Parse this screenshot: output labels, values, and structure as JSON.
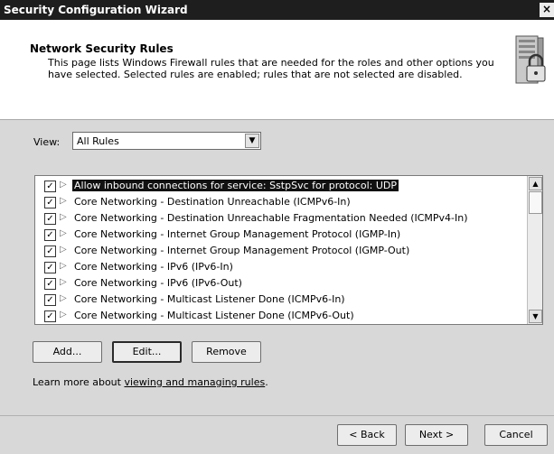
{
  "window": {
    "title": "Security Configuration Wizard",
    "close_glyph": "×"
  },
  "header": {
    "title": "Network Security Rules",
    "description": "This page lists Windows Firewall rules that are needed for the roles and other options you have selected. Selected rules are enabled; rules that are not selected are disabled.",
    "icon": "firewall-lock-icon"
  },
  "view": {
    "label": "View:",
    "selected": "All Rules"
  },
  "rules": [
    {
      "label": "Allow inbound connections for service: SstpSvc for protocol: UDP",
      "checked": true,
      "selected": true
    },
    {
      "label": "Core Networking - Destination Unreachable (ICMPv6-In)",
      "checked": true,
      "selected": false
    },
    {
      "label": "Core Networking - Destination Unreachable Fragmentation Needed (ICMPv4-In)",
      "checked": true,
      "selected": false
    },
    {
      "label": "Core Networking - Internet Group Management Protocol (IGMP-In)",
      "checked": true,
      "selected": false
    },
    {
      "label": "Core Networking - Internet Group Management Protocol (IGMP-Out)",
      "checked": true,
      "selected": false
    },
    {
      "label": "Core Networking - IPv6 (IPv6-In)",
      "checked": true,
      "selected": false
    },
    {
      "label": "Core Networking - IPv6 (IPv6-Out)",
      "checked": true,
      "selected": false
    },
    {
      "label": "Core Networking - Multicast Listener Done (ICMPv6-In)",
      "checked": true,
      "selected": false
    },
    {
      "label": "Core Networking - Multicast Listener Done (ICMPv6-Out)",
      "checked": true,
      "selected": false
    }
  ],
  "actions": {
    "add": "Add...",
    "edit": "Edit...",
    "remove": "Remove"
  },
  "learn_more": {
    "prefix": "Learn more about ",
    "link": "viewing and managing rules",
    "suffix": "."
  },
  "nav": {
    "back": "< Back",
    "next": "Next >",
    "cancel": "Cancel"
  }
}
